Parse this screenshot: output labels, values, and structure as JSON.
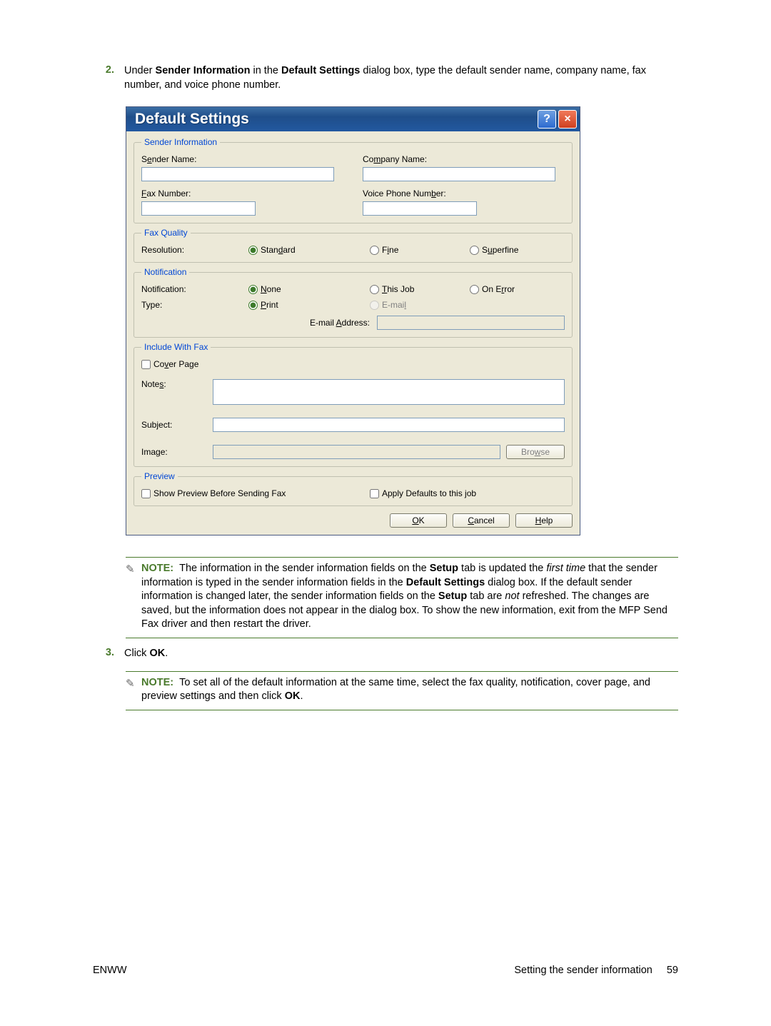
{
  "step2": {
    "num": "2.",
    "textParts": {
      "t1": "Under ",
      "b1": "Sender Information",
      "t2": " in the ",
      "b2": "Default Settings",
      "t3": " dialog box, type the default sender name, company name, fax number, and voice phone number."
    }
  },
  "dialog": {
    "title": "Default Settings",
    "sender": {
      "legend": "Sender Information",
      "senderName": {
        "pre": "S",
        "u": "e",
        "post": "nder Name:"
      },
      "companyName": {
        "pre": "Co",
        "u": "m",
        "post": "pany Name:"
      },
      "faxNumber": {
        "pre": "",
        "u": "F",
        "post": "ax Number:"
      },
      "voicePhone": {
        "pre": "Voice Phone Num",
        "u": "b",
        "post": "er:"
      }
    },
    "faxQuality": {
      "legend": "Fax Quality",
      "resolution": "Resolution:",
      "standard": {
        "pre": "Stan",
        "u": "d",
        "post": "ard"
      },
      "fine": {
        "pre": "F",
        "u": "i",
        "post": "ne"
      },
      "superfine": {
        "pre": "S",
        "u": "u",
        "post": "perfine"
      }
    },
    "notification": {
      "legend": "Notification",
      "notification": "Notification:",
      "none": {
        "pre": "",
        "u": "N",
        "post": "one"
      },
      "thisJob": {
        "pre": "",
        "u": "T",
        "post": "his Job"
      },
      "onError": {
        "pre": "On E",
        "u": "r",
        "post": "ror"
      },
      "type": "Type:",
      "print": {
        "pre": "",
        "u": "P",
        "post": "rint"
      },
      "email": {
        "pre": "E-mai",
        "u": "l",
        "post": ""
      },
      "emailAddress": {
        "pre": "E-mail ",
        "u": "A",
        "post": "ddress:"
      }
    },
    "include": {
      "legend": "Include With Fax",
      "coverPage": {
        "pre": "Co",
        "u": "v",
        "post": "er Page"
      },
      "notes": {
        "pre": "Note",
        "u": "s",
        "post": ":"
      },
      "subject": {
        "pre": "Sub",
        "u": "j",
        "post": "ect:"
      },
      "image": {
        "pre": "Ima",
        "u": "g",
        "post": "e:"
      },
      "browse": {
        "pre": "Bro",
        "u": "w",
        "post": "se"
      }
    },
    "preview": {
      "legend": "Preview",
      "showPreview": "Show Preview Before Sending Fax",
      "applyDefaults": "Apply Defaults to this job"
    },
    "buttons": {
      "ok": {
        "u": "O",
        "post": "K"
      },
      "cancel": {
        "u": "C",
        "post": "ancel"
      },
      "help": {
        "u": "H",
        "post": "elp"
      }
    }
  },
  "note1": {
    "label": "NOTE:",
    "t1": "The information in the sender information fields on the ",
    "b1": "Setup",
    "t2": " tab is updated the ",
    "i1": "first time",
    "t3": " that the sender information is typed in the sender information fields in the ",
    "b2": "Default Settings",
    "t4": " dialog box. If the default sender information is changed later, the sender information fields on the ",
    "b3": "Setup",
    "t5": " tab are ",
    "i2": "not",
    "t6": " refreshed. The changes are saved, but the information does not appear in the dialog box. To show the new information, exit from the MFP Send Fax driver and then restart the driver."
  },
  "step3": {
    "num": "3.",
    "t1": "Click ",
    "b1": "OK",
    "t2": "."
  },
  "note2": {
    "label": "NOTE:",
    "t1": "To set all of the default information at the same time, select the fax quality, notification, cover page, and preview settings and then click ",
    "b1": "OK",
    "t2": "."
  },
  "footer": {
    "left": "ENWW",
    "rightText": "Setting the sender information",
    "pageNum": "59"
  }
}
